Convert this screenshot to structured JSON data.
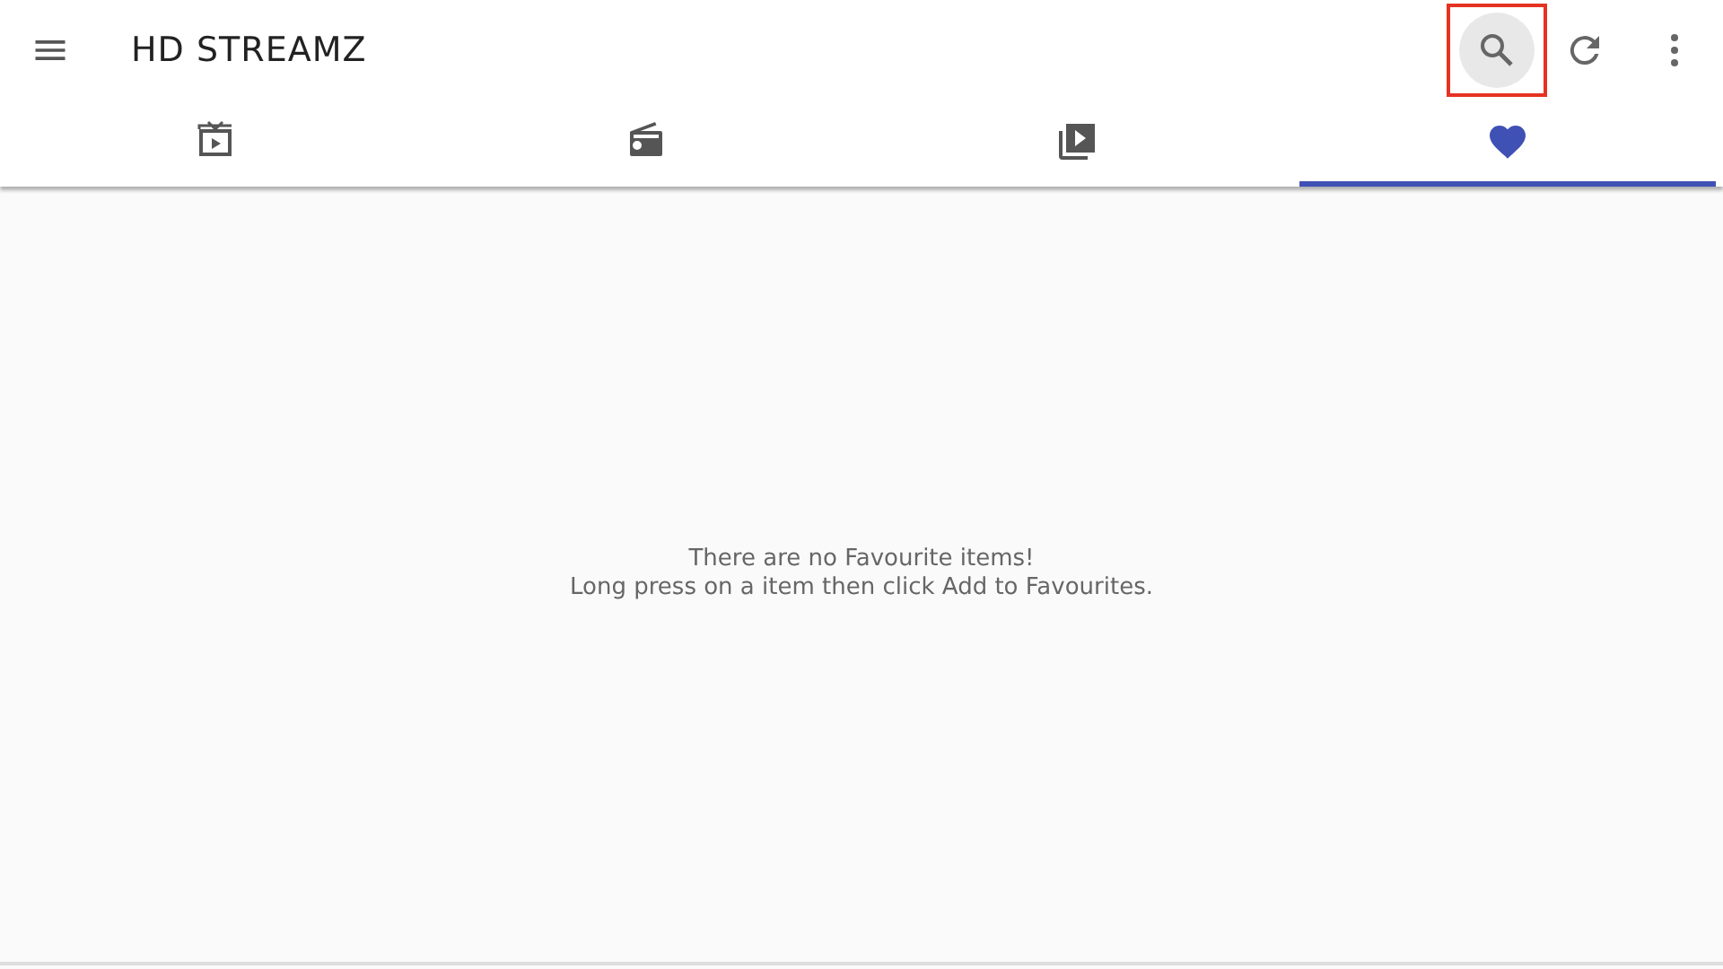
{
  "app_bar": {
    "title": "HD STREAMZ",
    "actions": [
      {
        "kind": "search",
        "highlighted": true
      },
      {
        "kind": "refresh",
        "highlighted": false
      },
      {
        "kind": "more",
        "highlighted": false
      }
    ]
  },
  "tabs": [
    {
      "kind": "tv",
      "selected": false
    },
    {
      "kind": "radio",
      "selected": false
    },
    {
      "kind": "video-library",
      "selected": false
    },
    {
      "kind": "favourites",
      "selected": true
    }
  ],
  "empty_message": {
    "lines": [
      "There are no Favourite items!",
      "Long press on a item then click Add to Favourites."
    ]
  }
}
